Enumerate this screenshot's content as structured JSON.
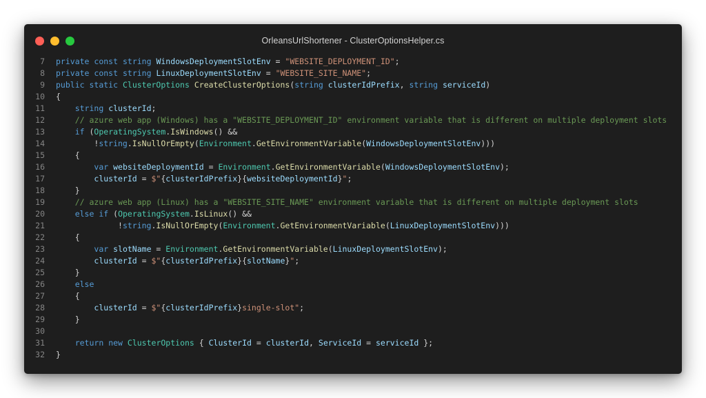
{
  "window": {
    "title": "OrleansUrlShortener - ClusterOptionsHelper.cs"
  },
  "colors": {
    "background": "#1e1e1e",
    "keyword": "#569cd6",
    "type": "#4ec9b0",
    "identifier": "#9cdcfe",
    "function": "#dcdcaa",
    "string": "#ce9178",
    "comment": "#6a9955",
    "punctuation": "#d4d4d4",
    "line_number": "#858585"
  },
  "code": {
    "lines": [
      {
        "n": "7",
        "tokens": [
          [
            "kw",
            "private"
          ],
          [
            "pu",
            " "
          ],
          [
            "kw",
            "const"
          ],
          [
            "pu",
            " "
          ],
          [
            "kw",
            "string"
          ],
          [
            "pu",
            " "
          ],
          [
            "id",
            "WindowsDeploymentSlotEnv"
          ],
          [
            "pu",
            " = "
          ],
          [
            "st",
            "\"WEBSITE_DEPLOYMENT_ID\""
          ],
          [
            "pu",
            ";"
          ]
        ]
      },
      {
        "n": "8",
        "tokens": [
          [
            "kw",
            "private"
          ],
          [
            "pu",
            " "
          ],
          [
            "kw",
            "const"
          ],
          [
            "pu",
            " "
          ],
          [
            "kw",
            "string"
          ],
          [
            "pu",
            " "
          ],
          [
            "id",
            "LinuxDeploymentSlotEnv"
          ],
          [
            "pu",
            " = "
          ],
          [
            "st",
            "\"WEBSITE_SITE_NAME\""
          ],
          [
            "pu",
            ";"
          ]
        ]
      },
      {
        "n": "9",
        "tokens": [
          [
            "kw",
            "public"
          ],
          [
            "pu",
            " "
          ],
          [
            "kw",
            "static"
          ],
          [
            "pu",
            " "
          ],
          [
            "ty",
            "ClusterOptions"
          ],
          [
            "pu",
            " "
          ],
          [
            "fn",
            "CreateClusterOptions"
          ],
          [
            "pu",
            "("
          ],
          [
            "kw",
            "string"
          ],
          [
            "pu",
            " "
          ],
          [
            "id",
            "clusterIdPrefix"
          ],
          [
            "pu",
            ", "
          ],
          [
            "kw",
            "string"
          ],
          [
            "pu",
            " "
          ],
          [
            "id",
            "serviceId"
          ],
          [
            "pu",
            ")"
          ]
        ]
      },
      {
        "n": "10",
        "tokens": [
          [
            "pu",
            "{"
          ]
        ]
      },
      {
        "n": "11",
        "tokens": [
          [
            "pu",
            "    "
          ],
          [
            "kw",
            "string"
          ],
          [
            "pu",
            " "
          ],
          [
            "id",
            "clusterId"
          ],
          [
            "pu",
            ";"
          ]
        ]
      },
      {
        "n": "12",
        "tokens": [
          [
            "pu",
            "    "
          ],
          [
            "cm",
            "// azure web app (Windows) has a \"WEBSITE_DEPLOYMENT_ID\" environment variable that is different on multiple deployment slots"
          ]
        ]
      },
      {
        "n": "13",
        "tokens": [
          [
            "pu",
            "    "
          ],
          [
            "kw",
            "if"
          ],
          [
            "pu",
            " ("
          ],
          [
            "ty",
            "OperatingSystem"
          ],
          [
            "pu",
            "."
          ],
          [
            "fn",
            "IsWindows"
          ],
          [
            "pu",
            "() &&"
          ]
        ]
      },
      {
        "n": "14",
        "tokens": [
          [
            "pu",
            "        !"
          ],
          [
            "kw",
            "string"
          ],
          [
            "pu",
            "."
          ],
          [
            "fn",
            "IsNullOrEmpty"
          ],
          [
            "pu",
            "("
          ],
          [
            "ty",
            "Environment"
          ],
          [
            "pu",
            "."
          ],
          [
            "fn",
            "GetEnvironmentVariable"
          ],
          [
            "pu",
            "("
          ],
          [
            "id",
            "WindowsDeploymentSlotEnv"
          ],
          [
            "pu",
            ")))"
          ]
        ]
      },
      {
        "n": "15",
        "tokens": [
          [
            "pu",
            "    {"
          ]
        ]
      },
      {
        "n": "16",
        "tokens": [
          [
            "pu",
            "        "
          ],
          [
            "kw",
            "var"
          ],
          [
            "pu",
            " "
          ],
          [
            "id",
            "websiteDeploymentId"
          ],
          [
            "pu",
            " = "
          ],
          [
            "ty",
            "Environment"
          ],
          [
            "pu",
            "."
          ],
          [
            "fn",
            "GetEnvironmentVariable"
          ],
          [
            "pu",
            "("
          ],
          [
            "id",
            "WindowsDeploymentSlotEnv"
          ],
          [
            "pu",
            ");"
          ]
        ]
      },
      {
        "n": "17",
        "tokens": [
          [
            "pu",
            "        "
          ],
          [
            "id",
            "clusterId"
          ],
          [
            "pu",
            " = "
          ],
          [
            "st",
            "$\""
          ],
          [
            "pu",
            "{"
          ],
          [
            "id",
            "clusterIdPrefix"
          ],
          [
            "pu",
            "}{"
          ],
          [
            "id",
            "websiteDeploymentId"
          ],
          [
            "pu",
            "}"
          ],
          [
            "st",
            "\""
          ],
          [
            "pu",
            ";"
          ]
        ]
      },
      {
        "n": "18",
        "tokens": [
          [
            "pu",
            "    }"
          ]
        ]
      },
      {
        "n": "19",
        "tokens": [
          [
            "pu",
            "    "
          ],
          [
            "cm",
            "// azure web app (Linux) has a \"WEBSITE_SITE_NAME\" environment variable that is different on multiple deployment slots"
          ]
        ]
      },
      {
        "n": "20",
        "tokens": [
          [
            "pu",
            "    "
          ],
          [
            "kw",
            "else"
          ],
          [
            "pu",
            " "
          ],
          [
            "kw",
            "if"
          ],
          [
            "pu",
            " ("
          ],
          [
            "ty",
            "OperatingSystem"
          ],
          [
            "pu",
            "."
          ],
          [
            "fn",
            "IsLinux"
          ],
          [
            "pu",
            "() &&"
          ]
        ]
      },
      {
        "n": "21",
        "tokens": [
          [
            "pu",
            "             !"
          ],
          [
            "kw",
            "string"
          ],
          [
            "pu",
            "."
          ],
          [
            "fn",
            "IsNullOrEmpty"
          ],
          [
            "pu",
            "("
          ],
          [
            "ty",
            "Environment"
          ],
          [
            "pu",
            "."
          ],
          [
            "fn",
            "GetEnvironmentVariable"
          ],
          [
            "pu",
            "("
          ],
          [
            "id",
            "LinuxDeploymentSlotEnv"
          ],
          [
            "pu",
            ")))"
          ]
        ]
      },
      {
        "n": "22",
        "tokens": [
          [
            "pu",
            "    {"
          ]
        ]
      },
      {
        "n": "23",
        "tokens": [
          [
            "pu",
            "        "
          ],
          [
            "kw",
            "var"
          ],
          [
            "pu",
            " "
          ],
          [
            "id",
            "slotName"
          ],
          [
            "pu",
            " = "
          ],
          [
            "ty",
            "Environment"
          ],
          [
            "pu",
            "."
          ],
          [
            "fn",
            "GetEnvironmentVariable"
          ],
          [
            "pu",
            "("
          ],
          [
            "id",
            "LinuxDeploymentSlotEnv"
          ],
          [
            "pu",
            ");"
          ]
        ]
      },
      {
        "n": "24",
        "tokens": [
          [
            "pu",
            "        "
          ],
          [
            "id",
            "clusterId"
          ],
          [
            "pu",
            " = "
          ],
          [
            "st",
            "$\""
          ],
          [
            "pu",
            "{"
          ],
          [
            "id",
            "clusterIdPrefix"
          ],
          [
            "pu",
            "}{"
          ],
          [
            "id",
            "slotName"
          ],
          [
            "pu",
            "}"
          ],
          [
            "st",
            "\""
          ],
          [
            "pu",
            ";"
          ]
        ]
      },
      {
        "n": "25",
        "tokens": [
          [
            "pu",
            "    }"
          ]
        ]
      },
      {
        "n": "26",
        "tokens": [
          [
            "pu",
            "    "
          ],
          [
            "kw",
            "else"
          ]
        ]
      },
      {
        "n": "27",
        "tokens": [
          [
            "pu",
            "    {"
          ]
        ]
      },
      {
        "n": "28",
        "tokens": [
          [
            "pu",
            "        "
          ],
          [
            "id",
            "clusterId"
          ],
          [
            "pu",
            " = "
          ],
          [
            "st",
            "$\""
          ],
          [
            "pu",
            "{"
          ],
          [
            "id",
            "clusterIdPrefix"
          ],
          [
            "pu",
            "}"
          ],
          [
            "st",
            "single-slot\""
          ],
          [
            "pu",
            ";"
          ]
        ]
      },
      {
        "n": "29",
        "tokens": [
          [
            "pu",
            "    }"
          ]
        ]
      },
      {
        "n": "30",
        "tokens": []
      },
      {
        "n": "31",
        "tokens": [
          [
            "pu",
            "    "
          ],
          [
            "kw",
            "return"
          ],
          [
            "pu",
            " "
          ],
          [
            "kw",
            "new"
          ],
          [
            "pu",
            " "
          ],
          [
            "ty",
            "ClusterOptions"
          ],
          [
            "pu",
            " { "
          ],
          [
            "id",
            "ClusterId"
          ],
          [
            "pu",
            " = "
          ],
          [
            "id",
            "clusterId"
          ],
          [
            "pu",
            ", "
          ],
          [
            "id",
            "ServiceId"
          ],
          [
            "pu",
            " = "
          ],
          [
            "id",
            "serviceId"
          ],
          [
            "pu",
            " };"
          ]
        ]
      },
      {
        "n": "32",
        "tokens": [
          [
            "pu",
            "}"
          ]
        ]
      }
    ]
  }
}
